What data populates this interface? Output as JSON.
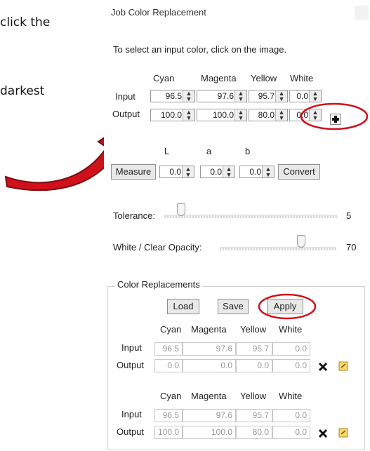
{
  "doc": {
    "line1": "click the",
    "line2": "darkest"
  },
  "dialog": {
    "title": "Job Color Replacement",
    "instruction": "To select an input color, click on the image.",
    "headers": [
      "Cyan",
      "Magenta",
      "Yellow",
      "White"
    ],
    "input_label": "Input",
    "output_label": "Output",
    "input_values": [
      "96.5",
      "97.6",
      "95.7",
      "0.0"
    ],
    "output_values": [
      "100.0",
      "100.0",
      "80.0",
      "0.0"
    ],
    "lab_headers": [
      "L",
      "a",
      "b"
    ],
    "measure_label": "Measure",
    "lab_values": [
      "0.0",
      "0.0",
      "0.0"
    ],
    "convert_label": "Convert",
    "tolerance_label": "Tolerance:",
    "tolerance_value": "5",
    "tolerance_level": 0.05,
    "opacity_label": "White / Clear Opacity:",
    "opacity_value": "70",
    "opacity_level": 0.7
  },
  "replacements": {
    "group_title": "Color Replacements",
    "load_label": "Load",
    "save_label": "Save",
    "apply_label": "Apply",
    "headers": [
      "Cyan",
      "Magenta",
      "Yellow",
      "White"
    ],
    "input_label": "Input",
    "output_label": "Output",
    "rows": [
      {
        "input": [
          "96.5",
          "97.6",
          "95.7",
          "0.0"
        ],
        "output": [
          "0.0",
          "0.0",
          "0.0",
          "0.0"
        ]
      },
      {
        "input": [
          "96.5",
          "97.6",
          "95.7",
          "0.0"
        ],
        "output": [
          "100.0",
          "100.0",
          "80.0",
          "0.0"
        ]
      }
    ]
  },
  "colors": {
    "annotation_red": "#d0101a",
    "accent": "#c00000"
  },
  "icons": {
    "add": "plus-icon",
    "delete": "x-icon",
    "edit": "note-icon"
  }
}
